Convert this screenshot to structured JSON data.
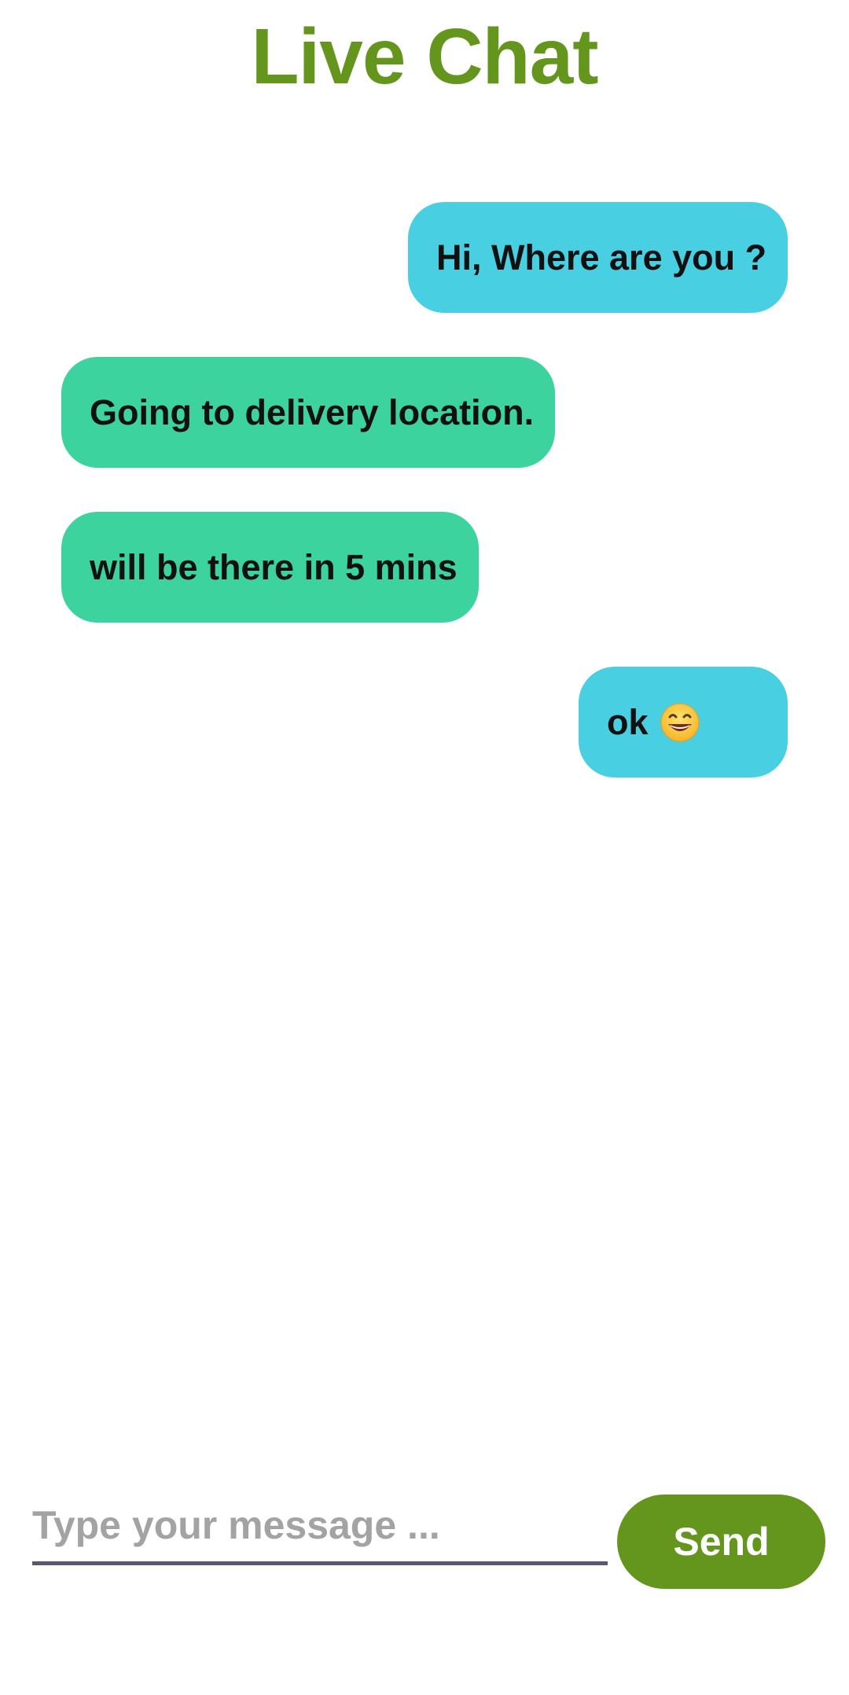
{
  "header": {
    "title": "Live Chat"
  },
  "messages": [
    {
      "sender": "me",
      "text": "Hi, Where are you ?"
    },
    {
      "sender": "them",
      "text": "Going to delivery location."
    },
    {
      "sender": "them",
      "text": "will be there in 5 mins"
    },
    {
      "sender": "me",
      "text": "ok",
      "emoji": "grinning-face-icon"
    }
  ],
  "composer": {
    "placeholder": "Type your message ...",
    "value": "",
    "send_label": "Send"
  },
  "colors": {
    "brand": "#64961e",
    "outgoing_bubble": "#49cfe2",
    "incoming_bubble": "#3dd39f",
    "placeholder_text": "#a3a3a3",
    "input_underline": "#5a5870"
  }
}
